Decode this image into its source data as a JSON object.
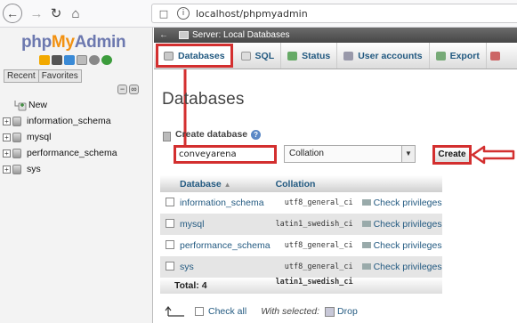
{
  "browser": {
    "url": "localhost/phpmyadmin",
    "back_icon": "back-arrow",
    "forward_icon": "forward-arrow",
    "reload_icon": "reload",
    "home_icon": "home"
  },
  "sidebar": {
    "logo_php": "php",
    "logo_my": "My",
    "logo_admin": "Admin",
    "tab_recent": "Recent",
    "tab_favorites": "Favorites",
    "tree": [
      {
        "label": "New",
        "type": "new"
      },
      {
        "label": "information_schema",
        "type": "db"
      },
      {
        "label": "mysql",
        "type": "db"
      },
      {
        "label": "performance_schema",
        "type": "db"
      },
      {
        "label": "sys",
        "type": "db"
      }
    ]
  },
  "main": {
    "server_bar": "Server: Local Databases",
    "menu": [
      {
        "label": "Databases",
        "active": true
      },
      {
        "label": "SQL",
        "active": false
      },
      {
        "label": "Status",
        "active": false
      },
      {
        "label": "User accounts",
        "active": false
      },
      {
        "label": "Export",
        "active": false
      }
    ],
    "page_title": "Databases",
    "create_label": "Create database",
    "db_name_value": "conveyarena",
    "collation_value": "Collation",
    "create_button": "Create",
    "table": {
      "col_database": "Database",
      "col_collation": "Collation",
      "rows": [
        {
          "name": "information_schema",
          "collation": "utf8_general_ci",
          "action": "Check privileges"
        },
        {
          "name": "mysql",
          "collation": "latin1_swedish_ci",
          "action": "Check privileges"
        },
        {
          "name": "performance_schema",
          "collation": "utf8_general_ci",
          "action": "Check privileges"
        },
        {
          "name": "sys",
          "collation": "utf8_general_ci",
          "action": "Check privileges"
        }
      ],
      "total_label": "Total: 4",
      "total_collation": "latin1_swedish_ci"
    },
    "check_all": "Check all",
    "with_selected": "With selected:",
    "drop": "Drop"
  },
  "colors": {
    "highlight_red": "#d32f2f",
    "link_blue": "#235a81",
    "logo_blue": "#6c78af",
    "logo_orange": "#f29111"
  }
}
